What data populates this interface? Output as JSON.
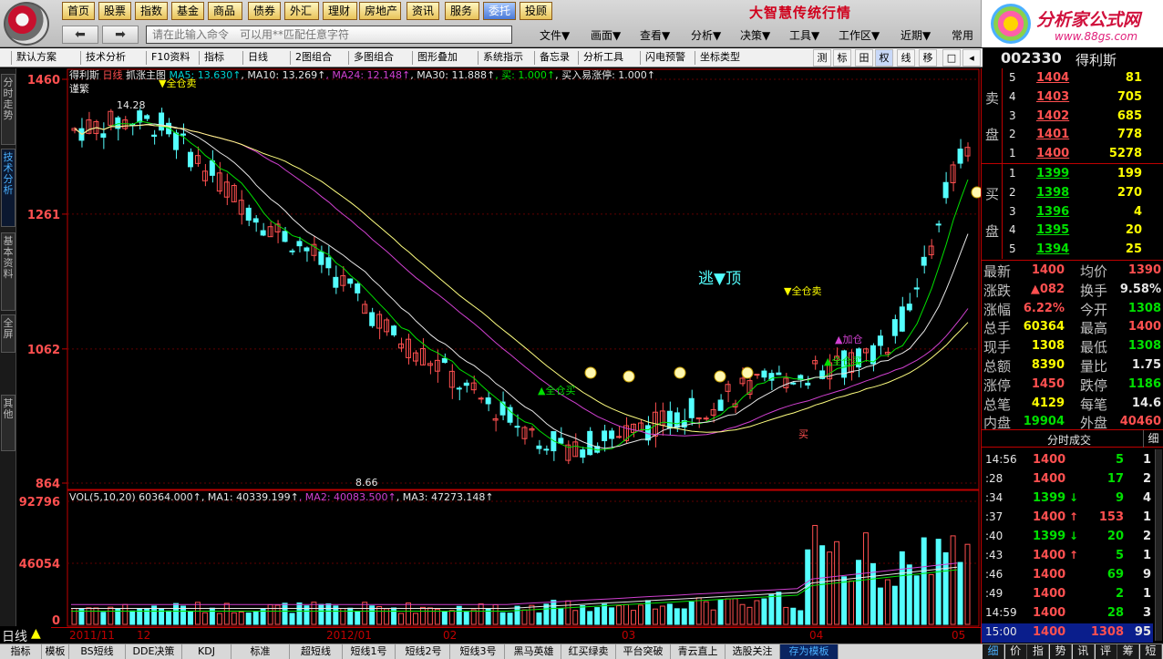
{
  "top_buttons": [
    "首页",
    "股票",
    "指数",
    "基金",
    "商品",
    "债券",
    "外汇",
    "理财",
    "房地产",
    "资讯",
    "服务",
    "委托",
    "投顾"
  ],
  "slogan": "大智慧传统行情",
  "brand": {
    "name": "分析家公式网",
    "url": "www.88gs.com"
  },
  "command_input": {
    "placeholder": "请在此输入命令　可以用**匹配任意字符"
  },
  "menus": [
    "文件▼",
    "画面▼",
    "查看▼",
    "分析▼",
    "决策▼",
    "工具▼",
    "工作区▼",
    "近期▼",
    "常用"
  ],
  "toolbar": {
    "items": [
      "默认方案",
      "技术分析",
      "F10资料",
      "指标",
      "日线",
      "2图组合",
      "多图组合",
      "图形叠加",
      "系统指示",
      "备忘录",
      "分析工具",
      "闪电预警",
      "坐标类型"
    ],
    "right_items": [
      "测",
      "标",
      "田",
      "权",
      "线",
      "移"
    ]
  },
  "stock": {
    "code": "002330",
    "name": "得利斯"
  },
  "left_tabs": [
    "分时走势",
    "技术分析",
    "基本资料",
    "全屏",
    "其他"
  ],
  "chart_header": {
    "name": "得利斯",
    "period": "日线",
    "indicator": "抓涨主图",
    "ma5": "MA5: 13.630",
    "ma10": "MA10: 13.269",
    "ma24": "MA24: 12.148",
    "ma30": "MA30: 11.888",
    "buy": "买: 1.000",
    "buy2": "买入易涨停: 1.000",
    "note": "谨繁",
    "sell_all_top": "全仓卖"
  },
  "vol_header": {
    "label": "VOL(5,10,20)",
    "vol": "60364.000",
    "ma1": "MA1: 40339.199",
    "ma2": "MA2: 40083.500",
    "ma3": "MA3: 47273.148"
  },
  "annotations": {
    "escape_top": "逃▼顶",
    "sell_all": "▼全仓卖",
    "buy_all_1": "▲全仓买",
    "buy_all_2": "▲全仓买",
    "add_pos": "▲加仓",
    "buy": "买",
    "high": "14.28",
    "low": "8.66"
  },
  "price_axis": [
    "1460",
    "1261",
    "1062",
    "864"
  ],
  "vol_axis": [
    "92796",
    "46054",
    "0"
  ],
  "dates": [
    "2011/11",
    "12",
    "2012/01",
    "02",
    "03",
    "04",
    "05"
  ],
  "period_label": "日线",
  "chart_data": {
    "type": "candlestick",
    "title": "得利斯 日线",
    "ylim": [
      864,
      1460
    ],
    "vol_ylim": [
      0,
      92796
    ],
    "x_axis_labels": [
      "2011/11",
      "12",
      "2012/01",
      "02",
      "03",
      "04",
      "05"
    ],
    "indicators": [
      {
        "name": "MA5",
        "value": 13.63
      },
      {
        "name": "MA10",
        "value": 13.269
      },
      {
        "name": "MA24",
        "value": 12.148
      },
      {
        "name": "MA30",
        "value": 11.888
      }
    ],
    "series": [
      {
        "name": "VOL",
        "value": 60364.0
      },
      {
        "name": "MA1",
        "value": 40339.199
      },
      {
        "name": "MA2",
        "value": 40083.5
      },
      {
        "name": "MA3",
        "value": 47273.148
      }
    ],
    "high_label": 14.28,
    "low_label": 8.66,
    "grid": true
  },
  "order_book": {
    "sell": [
      {
        "level": "5",
        "price": "1404",
        "vol": "81"
      },
      {
        "level": "4",
        "price": "1403",
        "vol": "705"
      },
      {
        "level": "3",
        "price": "1402",
        "vol": "685"
      },
      {
        "level": "2",
        "price": "1401",
        "vol": "778"
      },
      {
        "level": "1",
        "price": "1400",
        "vol": "5278"
      }
    ],
    "buy": [
      {
        "level": "1",
        "price": "1399",
        "vol": "199"
      },
      {
        "level": "2",
        "price": "1398",
        "vol": "270"
      },
      {
        "level": "3",
        "price": "1396",
        "vol": "4"
      },
      {
        "level": "4",
        "price": "1395",
        "vol": "20"
      },
      {
        "level": "5",
        "price": "1394",
        "vol": "25"
      }
    ],
    "sell_label": [
      "卖",
      "盘"
    ],
    "buy_label": [
      "买",
      "盘"
    ]
  },
  "quote": [
    {
      "l1": "最新",
      "v1": "1400",
      "l2": "均价",
      "v2": "1390"
    },
    {
      "l1": "涨跌",
      "v1": "▲082",
      "l2": "换手",
      "v2": "9.58%"
    },
    {
      "l1": "涨幅",
      "v1": "6.22%",
      "l2": "今开",
      "v2": "1308"
    },
    {
      "l1": "总手",
      "v1": "60364",
      "l2": "最高",
      "v2": "1400"
    },
    {
      "l1": "现手",
      "v1": "1308",
      "l2": "最低",
      "v2": "1308"
    },
    {
      "l1": "总额",
      "v1": "8390",
      "l2": "量比",
      "v2": "1.75"
    },
    {
      "l1": "涨停",
      "v1": "1450",
      "l2": "跌停",
      "v2": "1186"
    },
    {
      "l1": "总笔",
      "v1": "4129",
      "l2": "每笔",
      "v2": "14.6"
    },
    {
      "l1": "内盘",
      "v1": "19904",
      "l2": "外盘",
      "v2": "40460"
    }
  ],
  "ticks_header": {
    "title": "分时成交",
    "detail": "细"
  },
  "ticks": [
    {
      "t": "14:56",
      "p": "1400",
      "a": "",
      "v": "5",
      "n": "1"
    },
    {
      "t": ":28",
      "p": "1400",
      "a": "",
      "v": "17",
      "n": "2"
    },
    {
      "t": ":34",
      "p": "1399",
      "a": "↓",
      "v": "9",
      "n": "4"
    },
    {
      "t": ":37",
      "p": "1400",
      "a": "↑",
      "v": "153",
      "n": "1"
    },
    {
      "t": ":40",
      "p": "1399",
      "a": "↓",
      "v": "20",
      "n": "2"
    },
    {
      "t": ":43",
      "p": "1400",
      "a": "↑",
      "v": "5",
      "n": "1"
    },
    {
      "t": ":46",
      "p": "1400",
      "a": "",
      "v": "69",
      "n": "9"
    },
    {
      "t": ":49",
      "p": "1400",
      "a": "",
      "v": "2",
      "n": "1"
    },
    {
      "t": "14:59",
      "p": "1400",
      "a": "",
      "v": "28",
      "n": "3"
    },
    {
      "t": "15:00",
      "p": "1400",
      "a": "",
      "v": "1308",
      "n": "95"
    }
  ],
  "bottom_tabs": [
    "指标",
    "模板",
    "BS短线",
    "DDE决策",
    "KDJ",
    "标准",
    "超短线",
    "短线1号",
    "短线2号",
    "短线3号",
    "黑马英雄",
    "红买绿卖",
    "平台突破",
    "青云直上",
    "选股关注",
    "存为模板"
  ],
  "right_bottom_tabs": [
    "细",
    "价",
    "指",
    "势",
    "讯",
    "评",
    "筹",
    "短"
  ]
}
